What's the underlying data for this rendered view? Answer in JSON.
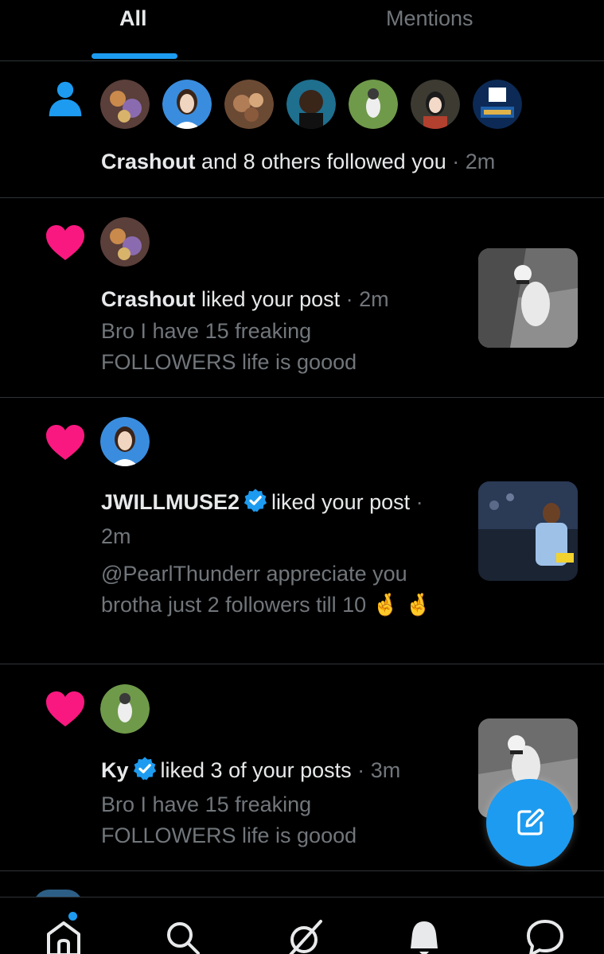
{
  "tabs": {
    "all": "All",
    "mentions": "Mentions"
  },
  "notifications": [
    {
      "type": "follow",
      "icon": "person-icon",
      "name": "Crashout",
      "action": "and 8 others followed you",
      "separator": "·",
      "time": "2m",
      "avatars": [
        "avatar-1",
        "avatar-2",
        "avatar-3",
        "avatar-4",
        "avatar-5",
        "avatar-6",
        "avatar-7"
      ]
    },
    {
      "type": "like",
      "icon": "heart-icon",
      "name": "Crashout",
      "action": "liked your post",
      "separator": "·",
      "time": "2m",
      "snippet": "Bro I have 15 freaking FOLLOWERS life is goood"
    },
    {
      "type": "like",
      "icon": "heart-icon",
      "name": "JWILLMUSE2",
      "verified": true,
      "action": "liked your post",
      "separator": "·",
      "time": "2m",
      "snippet": "@PearlThunderr  appreciate you brotha just 2 followers till 10",
      "emoji": "🤞"
    },
    {
      "type": "like",
      "icon": "heart-icon",
      "name": "Ky",
      "verified": true,
      "action": "liked 3 of your posts",
      "separator": "·",
      "time": "3m",
      "snippet": "Bro I have 15 freaking FOLLOWERS life is goood"
    }
  ],
  "compose_button": {
    "icon": "compose-icon"
  },
  "bottom_nav": [
    "home-icon",
    "search-icon",
    "grok-icon",
    "bell-icon",
    "messages-icon"
  ],
  "colors": {
    "accent": "#1d9bf0",
    "heart": "#f91880",
    "background": "#000000",
    "muted": "#71767b"
  }
}
